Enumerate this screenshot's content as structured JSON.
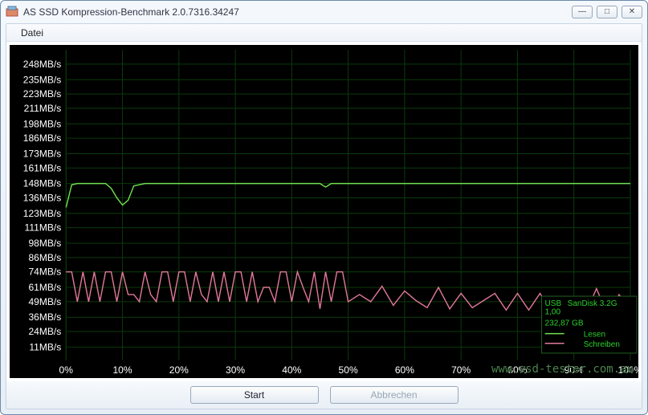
{
  "window": {
    "title": "AS SSD Kompression-Benchmark 2.0.7316.34247",
    "min_label": "—",
    "max_label": "□",
    "close_label": "✕"
  },
  "menubar": {
    "file_label": "Datei"
  },
  "buttons": {
    "start_label": "Start",
    "cancel_label": "Abbrechen"
  },
  "watermark": "www.ssd-tester.com.au",
  "legend": {
    "device_line1": "USB",
    "device_line2": "1,00",
    "device_line3": "SanDisk 3.2G",
    "capacity": "232,87 GB",
    "read_label": "Lesen",
    "write_label": "Schreiben"
  },
  "chart_data": {
    "type": "line",
    "xlabel": "",
    "ylabel": "",
    "x_ticks": [
      "0%",
      "10%",
      "20%",
      "30%",
      "40%",
      "50%",
      "60%",
      "70%",
      "80%",
      "90%",
      "100%"
    ],
    "y_ticks": [
      "11MB/s",
      "24MB/s",
      "36MB/s",
      "49MB/s",
      "61MB/s",
      "74MB/s",
      "86MB/s",
      "98MB/s",
      "111MB/s",
      "123MB/s",
      "136MB/s",
      "148MB/s",
      "161MB/s",
      "173MB/s",
      "186MB/s",
      "198MB/s",
      "211MB/s",
      "223MB/s",
      "235MB/s",
      "248MB/s"
    ],
    "ylim": [
      0,
      260
    ],
    "xlim": [
      0,
      100
    ],
    "series": [
      {
        "name": "Lesen",
        "color": "#70e050",
        "x": [
          0,
          1,
          2,
          3,
          5,
          7,
          8,
          9,
          10,
          11,
          12,
          14,
          20,
          30,
          40,
          45,
          46,
          47,
          50,
          60,
          70,
          80,
          90,
          100
        ],
        "y": [
          128,
          147,
          148,
          148,
          148,
          148,
          144,
          136,
          130,
          134,
          146,
          148,
          148,
          148,
          148,
          148,
          145,
          148,
          148,
          148,
          148,
          148,
          148,
          148
        ]
      },
      {
        "name": "Schreiben",
        "color": "#e07897",
        "x": [
          0,
          1,
          2,
          3,
          4,
          5,
          6,
          7,
          8,
          9,
          10,
          11,
          12,
          13,
          14,
          15,
          16,
          17,
          18,
          19,
          20,
          21,
          22,
          23,
          24,
          25,
          26,
          27,
          28,
          29,
          30,
          31,
          32,
          33,
          34,
          35,
          36,
          37,
          38,
          39,
          40,
          41,
          42,
          43,
          44,
          45,
          46,
          47,
          48,
          49,
          50,
          52,
          54,
          56,
          58,
          60,
          62,
          64,
          66,
          68,
          70,
          72,
          74,
          76,
          78,
          80,
          82,
          84,
          85,
          86,
          87,
          88,
          90,
          92,
          94,
          96,
          98,
          100
        ],
        "y": [
          74,
          74,
          49,
          74,
          49,
          74,
          49,
          74,
          74,
          49,
          74,
          55,
          55,
          49,
          74,
          55,
          49,
          74,
          74,
          49,
          74,
          74,
          49,
          74,
          55,
          49,
          74,
          49,
          74,
          49,
          74,
          74,
          49,
          74,
          49,
          61,
          61,
          49,
          74,
          74,
          49,
          74,
          61,
          49,
          74,
          43,
          74,
          49,
          74,
          74,
          49,
          55,
          49,
          62,
          46,
          58,
          50,
          44,
          61,
          43,
          56,
          44,
          50,
          56,
          42,
          56,
          42,
          56,
          48,
          30,
          48,
          38,
          52,
          38,
          60,
          38,
          55,
          44
        ]
      }
    ]
  }
}
